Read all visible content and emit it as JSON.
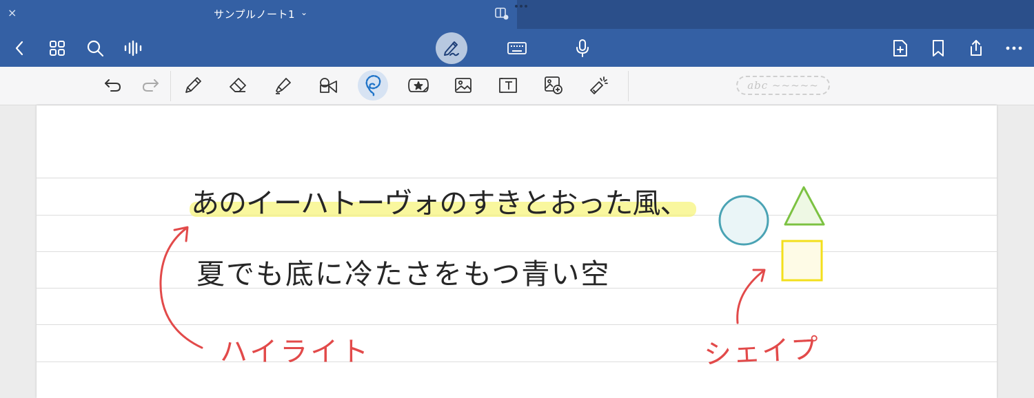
{
  "titlebar": {
    "close_glyph": "×",
    "document_title": "サンプルノート1",
    "title_chevron": "⌄"
  },
  "navbar": {
    "icons": [
      "back-icon",
      "grid-icon",
      "search-icon",
      "audio-waveform-icon",
      "pen-mode-icon",
      "keyboard-icon",
      "microphone-icon",
      "add-page-icon",
      "bookmark-icon",
      "share-icon",
      "more-icon"
    ],
    "active_mode": "handwriting"
  },
  "toolbar": {
    "tools": [
      "undo",
      "redo",
      "pen",
      "eraser",
      "highlighter",
      "shape",
      "lasso",
      "sticker",
      "image",
      "text-box",
      "camera",
      "laser-pointer"
    ],
    "selected_tool": "lasso",
    "handwriting_pill_text": "abc ~~~~~"
  },
  "page": {
    "line1": "あのイーハトーヴォのすきとおった風、",
    "line2": "夏でも底に冷たさをもつ青い空",
    "label_highlight": "ハイライト",
    "label_shapes": "シェイプ",
    "shapes": [
      {
        "kind": "circle",
        "stroke": "#4aa3b4",
        "fill": "#eaf5f7"
      },
      {
        "kind": "triangle",
        "stroke": "#7cc242",
        "fill": "#eef8e4"
      },
      {
        "kind": "square",
        "stroke": "#f3df1c",
        "fill": "#fefbe6"
      }
    ],
    "highlight_color": "#f6f36a",
    "annotation_color": "#e24a4a"
  },
  "colors": {
    "bar_blue": "#3460a4",
    "bar_dark": "#2b4f8a",
    "toolbar_bg": "#f6f6f7",
    "selected_bg": "#d7e3f3"
  }
}
